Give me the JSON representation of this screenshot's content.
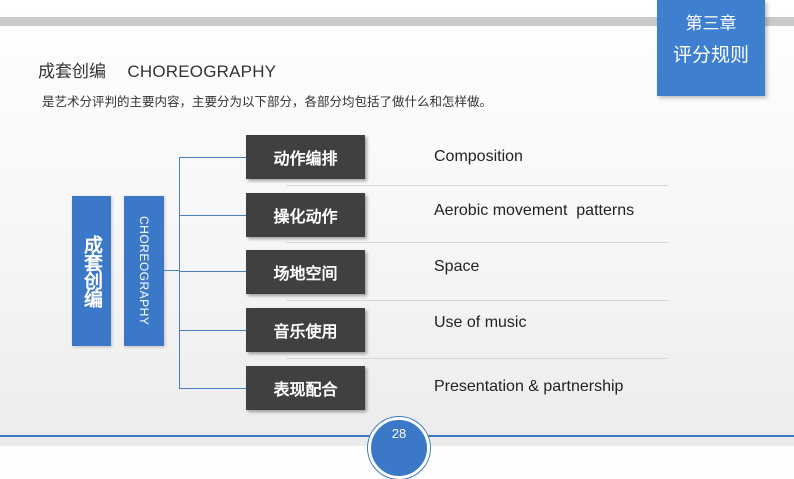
{
  "chapter": {
    "number": "第三章",
    "title": "评分规则"
  },
  "heading": {
    "zh": "成套创编",
    "en": "CHOREOGRAPHY"
  },
  "intro": "是艺术分评判的主要内容，主要分为以下部分，各部分均包括了做什么和怎样做。",
  "side_labels": {
    "zh": "成套创编",
    "en": "CHOREOGRAPHY"
  },
  "items": [
    {
      "zh": "动作编排",
      "en": "Composition"
    },
    {
      "zh": "操化动作",
      "en": "Aerobic movement  patterns"
    },
    {
      "zh": "场地空间",
      "en": "Space"
    },
    {
      "zh": "音乐使用",
      "en": "Use of music"
    },
    {
      "zh": "表现配合",
      "en": "Presentation & partnership"
    }
  ],
  "page_number": "28",
  "colors": {
    "accent": "#3b78c8",
    "item_box": "#404040"
  }
}
